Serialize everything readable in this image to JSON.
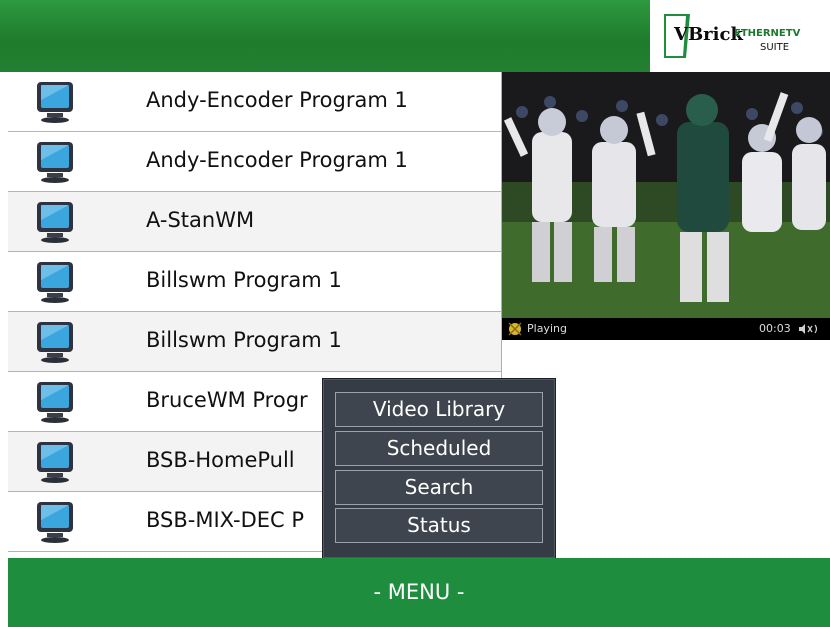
{
  "brand": {
    "logo_main": "VBrick",
    "logo_product": "ETHERNETV",
    "logo_suite": "SUITE"
  },
  "programs": [
    {
      "name": "Andy-Encoder Program 1"
    },
    {
      "name": "Andy-Encoder Program 1"
    },
    {
      "name": "A-StanWM"
    },
    {
      "name": "Billswm Program 1"
    },
    {
      "name": "Billswm Program 1"
    },
    {
      "name": "BruceWM Progr"
    },
    {
      "name": "BSB-HomePull"
    },
    {
      "name": "BSB-MIX-DEC P"
    }
  ],
  "player": {
    "state": "Playing",
    "time": "00:03"
  },
  "popup_menu": {
    "items": [
      "Video Library",
      "Scheduled",
      "Search",
      "Status"
    ]
  },
  "footer": {
    "menu_label": "- MENU -"
  },
  "colors": {
    "header_green": "#237f31",
    "footer_green": "#1f8d3e",
    "popup_bg": "#353c45"
  }
}
